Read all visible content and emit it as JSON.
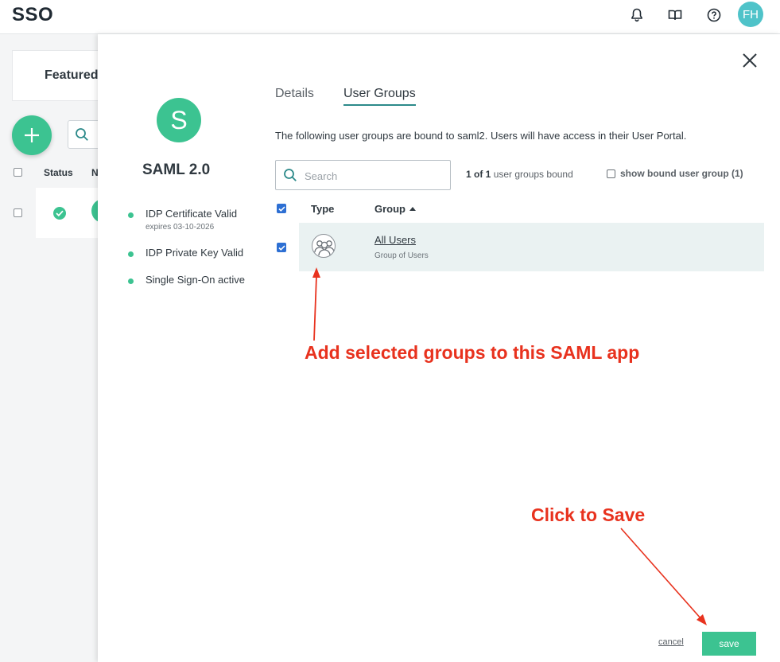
{
  "topbar": {
    "title": "SSO",
    "icons": [
      "bell-icon",
      "book-icon",
      "help-icon"
    ],
    "avatar_initials": "FH"
  },
  "background": {
    "card_title": "Featured",
    "table": {
      "status_header": "Status",
      "name_header": "N"
    }
  },
  "panel": {
    "app": {
      "initial": "S",
      "name": "SAML 2.0",
      "status_items": [
        {
          "label": "IDP Certificate Valid",
          "sub": "expires 03-10-2026"
        },
        {
          "label": "IDP Private Key Valid",
          "sub": ""
        },
        {
          "label": "Single Sign-On active",
          "sub": ""
        }
      ]
    },
    "tabs": [
      {
        "label": "Details",
        "active": false
      },
      {
        "label": "User Groups",
        "active": true
      }
    ],
    "description": "The following user groups are bound to saml2. Users will have access in their User Portal.",
    "search": {
      "placeholder": "Search",
      "value": ""
    },
    "bound": {
      "count": "1 of 1",
      "suffix": "user groups bound"
    },
    "show_bound_label": "show bound user group (1)",
    "table": {
      "columns": {
        "type": "Type",
        "group": "Group"
      },
      "rows": [
        {
          "name": "All Users",
          "type": "Group of Users",
          "checked": true
        }
      ]
    },
    "annotations": {
      "add_groups": "Add selected groups to this SAML app",
      "click_save": "Click to Save"
    },
    "footer": {
      "cancel_label": "cancel",
      "save_label": "save"
    }
  },
  "colors": {
    "accent": "#3cc391",
    "annotation": "#e8321e",
    "checkbox": "#2d6fd3",
    "tab_underline": "#2c8a8a",
    "avatar": "#4fc3c9"
  }
}
